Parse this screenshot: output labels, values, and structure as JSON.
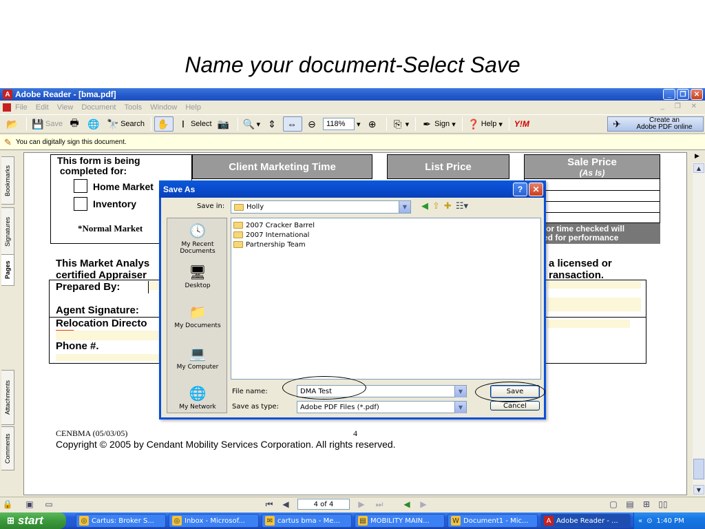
{
  "slide": {
    "title": "Name your document-Select Save"
  },
  "app": {
    "title": "Adobe Reader - [bma.pdf]",
    "menu": [
      "File",
      "Edit",
      "View",
      "Document",
      "Tools",
      "Window",
      "Help"
    ],
    "toolbar": {
      "save": "Save",
      "search": "Search",
      "select": "Select",
      "zoom": "118%",
      "sign": "Sign",
      "help": "Help",
      "ym": "Y!M",
      "create_pdf_line1": "Create an",
      "create_pdf_line2": "Adobe PDF online"
    },
    "notice": "You can digitally sign this document.",
    "sidetabs": [
      "Bookmarks",
      "Signatures",
      "Pages",
      "Attachments",
      "Comments"
    ],
    "page_nav": "4 of 4"
  },
  "document": {
    "form_completed_for_1": "This form is being",
    "form_completed_for_2": "completed for:",
    "home_market": "Home Market",
    "inventory": "Inventory",
    "normal_market": "*Normal Market",
    "client_marketing_time": "Client Marketing Time",
    "list_price": "List Price",
    "sale_price": "Sale Price",
    "as_is": "(As Is)",
    "note_1": "ues for time checked will",
    "note_2": "e used for performance",
    "analysis_1": "This Market Analys",
    "analysis_2": "certified Appraiser",
    "licensed_1": "a licensed or",
    "licensed_2": "ransaction.",
    "prepared_by": "Prepared By:",
    "agent_signature": "Agent Signature:",
    "relocation_director": "Relocation Directo",
    "phone": "Phone #.",
    "footer_code": "CENBMA (05/03/05)",
    "footer_page": "4",
    "copyright": "Copyright © 2005 by Cendant Mobility Services Corporation. All rights reserved."
  },
  "dialog": {
    "title": "Save As",
    "save_in_label": "Save in:",
    "save_in_value": "Holly",
    "places": [
      "My Recent Documents",
      "Desktop",
      "My Documents",
      "My Computer",
      "My Network"
    ],
    "files": [
      "2007 Cracker Barrel",
      "2007 International",
      "Partnership Team"
    ],
    "file_name_label": "File name:",
    "file_name_value": "DMA Test",
    "save_type_label": "Save as type:",
    "save_type_value": "Adobe PDF Files (*.pdf)",
    "save_button": "Save",
    "cancel_button": "Cancel"
  },
  "taskbar": {
    "start": "start",
    "tasks": [
      "Cartus: Broker S...",
      "Inbox - Microsof...",
      "cartus bma - Me...",
      "MOBILITY MAIN...",
      "Document1 - Mic...",
      "Adobe Reader - ..."
    ],
    "clock": "1:40 PM"
  }
}
